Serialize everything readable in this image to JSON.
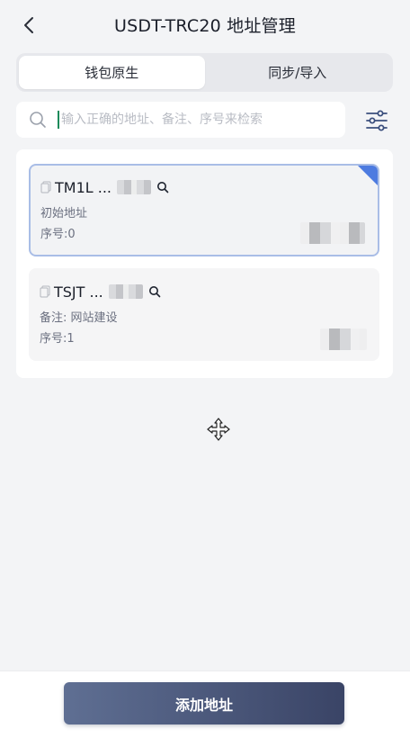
{
  "header": {
    "title": "USDT-TRC20 地址管理"
  },
  "tabs": [
    {
      "label": "钱包原生",
      "active": true
    },
    {
      "label": "同步/导入",
      "active": false
    }
  ],
  "search": {
    "placeholder": "输入正确的地址、备注、序号来检索",
    "value": ""
  },
  "addresses": [
    {
      "address": "TM1L ...",
      "label": "初始地址",
      "index": "序号:0",
      "selected": true
    },
    {
      "address": "TSJT ...",
      "label": "备注: 网站建设",
      "index": "序号:1",
      "selected": false
    }
  ],
  "bottom": {
    "add_label": "添加地址"
  },
  "colors": {
    "accent": "#4d7be0",
    "button_start": "#5f6f93",
    "button_end": "#3a4466",
    "background": "#f3f4f6"
  },
  "icons": {
    "back": "chevron-left-icon",
    "search": "search-icon",
    "filter": "sliders-icon",
    "copy": "copy-icon",
    "lookup": "magnifier-icon",
    "cursor": "move-cursor-icon"
  }
}
